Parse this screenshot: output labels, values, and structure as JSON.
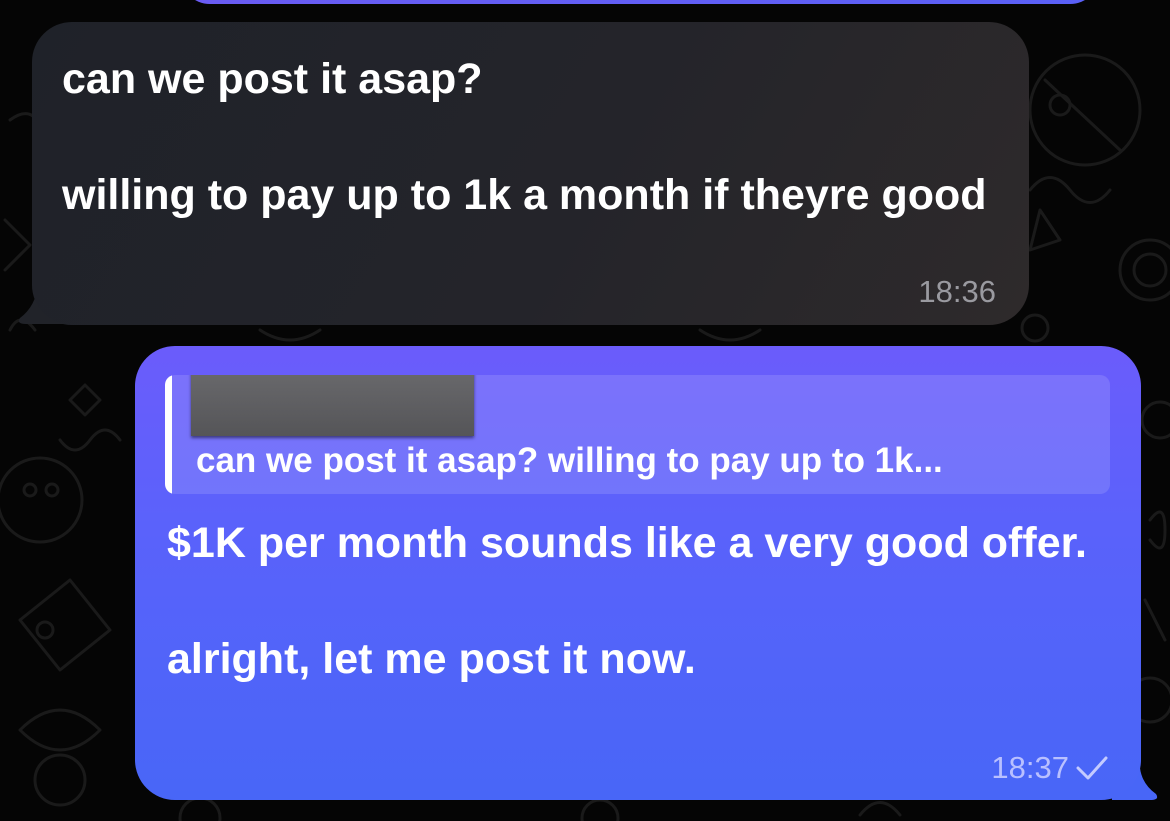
{
  "incoming_message": {
    "text": "can we post it asap?\n\nwilling to pay up to 1k a month if theyre good",
    "time": "18:36"
  },
  "outgoing_message": {
    "reply_snippet": "can we post it asap? willing to pay up to 1k...",
    "text": "$1K per month sounds like a very good offer.\n\nalright, let me post it now.",
    "time": "18:37",
    "status_icon": "single-check-icon"
  },
  "colors": {
    "background": "#050505",
    "incoming_bubble": "#24242a",
    "outgoing_bubble_top": "#6b5cfb",
    "outgoing_bubble_bottom": "#4866f7"
  }
}
